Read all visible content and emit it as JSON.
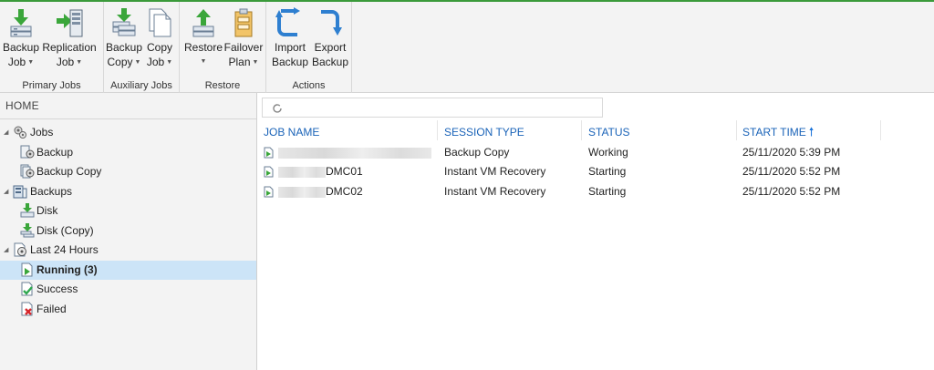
{
  "ribbon": {
    "groups": [
      {
        "label": "Primary Jobs"
      },
      {
        "label": "Auxiliary Jobs"
      },
      {
        "label": "Restore"
      },
      {
        "label": "Actions"
      }
    ],
    "buttons": {
      "backup_job": {
        "line1": "Backup",
        "line2": "Job",
        "icon": "backup-job-icon"
      },
      "replication_job": {
        "line1": "Replication",
        "line2": "Job",
        "icon": "replication-job-icon"
      },
      "backup_copy": {
        "line1": "Backup",
        "line2": "Copy",
        "icon": "backup-copy-icon"
      },
      "copy_job": {
        "line1": "Copy",
        "line2": "Job",
        "icon": "copy-job-icon"
      },
      "restore": {
        "line1": "Restore",
        "line2": "",
        "icon": "restore-icon"
      },
      "failover_plan": {
        "line1": "Failover",
        "line2": "Plan",
        "icon": "failover-plan-icon"
      },
      "import_backup": {
        "line1": "Import",
        "line2": "Backup",
        "icon": "import-backup-icon"
      },
      "export_backup": {
        "line1": "Export",
        "line2": "Backup",
        "icon": "export-backup-icon"
      }
    },
    "accent_color": "#3a9a3a"
  },
  "nav": {
    "title": "HOME",
    "tree": [
      {
        "label": "Jobs",
        "icon": "jobs-gear-icon",
        "expandable": true
      },
      {
        "label": "Backup",
        "icon": "backup-gear-icon"
      },
      {
        "label": "Backup Copy",
        "icon": "backup-copy-gear-icon"
      },
      {
        "label": "Backups",
        "icon": "backups-icon",
        "expandable": true
      },
      {
        "label": "Disk",
        "icon": "disk-icon"
      },
      {
        "label": "Disk (Copy)",
        "icon": "disk-copy-icon"
      },
      {
        "label": "Last 24 Hours",
        "icon": "last-24-hours-icon",
        "expandable": true
      },
      {
        "label": "Running (3)",
        "icon": "running-icon",
        "selected": true
      },
      {
        "label": "Success",
        "icon": "success-icon"
      },
      {
        "label": "Failed",
        "icon": "failed-icon"
      }
    ],
    "selected_color": "#cce4f7"
  },
  "main": {
    "search": {
      "icon": "search-icon",
      "placeholder": ""
    },
    "columns": [
      "JOB NAME",
      "SESSION TYPE",
      "STATUS",
      "START TIME"
    ],
    "sort": {
      "column": "START TIME",
      "direction": "ascending",
      "icon": "sort-up-arrow-icon"
    },
    "header_color": "#1a63b8",
    "rows": [
      {
        "job_name": "",
        "session_type": "Backup Copy",
        "status": "Working",
        "start_time": "25/11/2020 5:39 PM"
      },
      {
        "job_name": "DMC01",
        "session_type": "Instant VM Recovery",
        "status": "Starting",
        "start_time": "25/11/2020 5:52 PM"
      },
      {
        "job_name": "DMC02",
        "session_type": "Instant VM Recovery",
        "status": "Starting",
        "start_time": "25/11/2020 5:52 PM"
      }
    ]
  }
}
